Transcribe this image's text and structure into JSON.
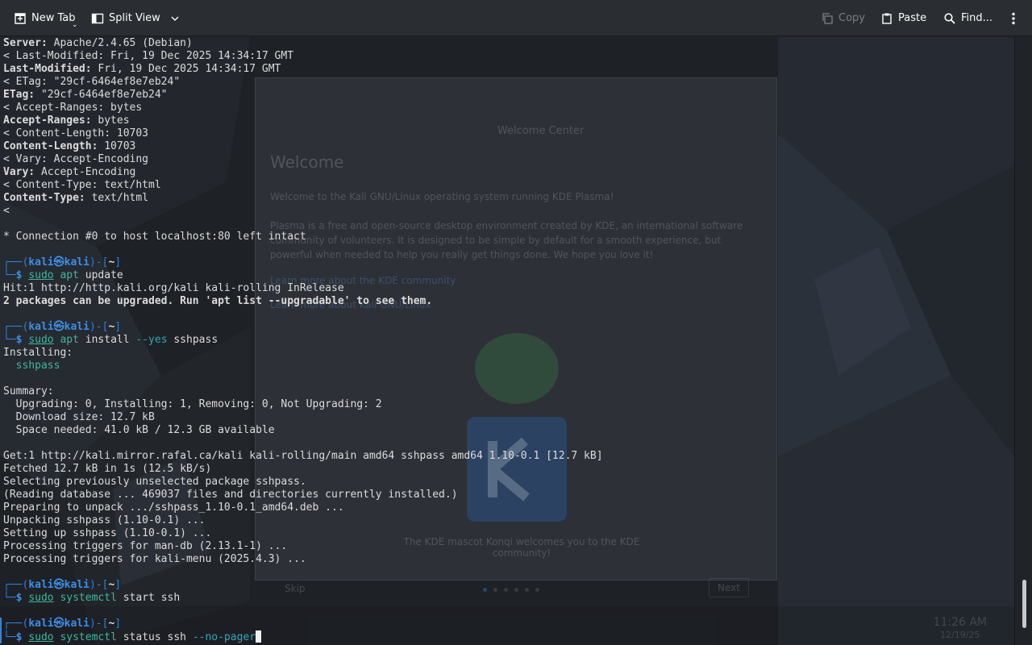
{
  "toolbar": {
    "new_tab": "New Tab",
    "split_view": "Split View",
    "copy": "Copy",
    "paste": "Paste",
    "find": "Find..."
  },
  "terminal": {
    "http_headers": [
      {
        "key": "Server:",
        "value": " Apache/2.4.65 (Debian)"
      },
      {
        "raw": "< Last-Modified: Fri, 19 Dec 2025 14:34:17 GMT"
      },
      {
        "key": "Last-Modified:",
        "value": " Fri, 19 Dec 2025 14:34:17 GMT"
      },
      {
        "raw": "< ETag: \"29cf-6464ef8e7eb24\""
      },
      {
        "key": "ETag:",
        "value": " \"29cf-6464ef8e7eb24\""
      },
      {
        "raw": "< Accept-Ranges: bytes"
      },
      {
        "key": "Accept-Ranges:",
        "value": " bytes"
      },
      {
        "raw": "< Content-Length: 10703"
      },
      {
        "key": "Content-Length:",
        "value": " 10703"
      },
      {
        "raw": "< Vary: Accept-Encoding"
      },
      {
        "key": "Vary:",
        "value": " Accept-Encoding"
      },
      {
        "raw": "< Content-Type: text/html"
      },
      {
        "key": "Content-Type:",
        "value": " text/html"
      },
      {
        "raw": "<"
      },
      {
        "raw": ""
      },
      {
        "raw": "* Connection #0 to host localhost:80 left intact"
      },
      {
        "raw": ""
      }
    ],
    "prompt": {
      "user": "kali",
      "host": "kali",
      "dir": "~",
      "symbol": "$"
    },
    "blocks": [
      {
        "command": [
          "sudo",
          " ",
          "apt",
          " update"
        ],
        "output": [
          {
            "text": "Hit:1 http://http.kali.org/kali kali-rolling InRelease"
          },
          {
            "text": "2 packages can be upgraded. Run 'apt list --upgradable' to see them.",
            "bold": true
          },
          {
            "text": ""
          }
        ]
      },
      {
        "command": [
          "sudo",
          " ",
          "apt",
          " install ",
          "--yes",
          " sshpass"
        ],
        "output": [
          {
            "text": "Installing:"
          },
          {
            "text": "  sshpass",
            "green": true
          },
          {
            "text": ""
          },
          {
            "text": "Summary:"
          },
          {
            "text": "  Upgrading: 0, Installing: 1, Removing: 0, Not Upgrading: 2"
          },
          {
            "text": "  Download size: 12.7 kB"
          },
          {
            "text": "  Space needed: 41.0 kB / 12.3 GB available"
          },
          {
            "text": ""
          },
          {
            "text": "Get:1 http://kali.mirror.rafal.ca/kali kali-rolling/main amd64 sshpass amd64 1.10-0.1 [12.7 kB]"
          },
          {
            "text": "Fetched 12.7 kB in 1s (12.5 kB/s)"
          },
          {
            "text": "Selecting previously unselected package sshpass."
          },
          {
            "text": "(Reading database ... 469037 files and directories currently installed.)"
          },
          {
            "text": "Preparing to unpack .../sshpass_1.10-0.1_amd64.deb ..."
          },
          {
            "text": "Unpacking sshpass (1.10-0.1) ..."
          },
          {
            "text": "Setting up sshpass (1.10-0.1) ..."
          },
          {
            "text": "Processing triggers for man-db (2.13.1-1) ..."
          },
          {
            "text": "Processing triggers for kali-menu (2025.4.3) ..."
          },
          {
            "text": ""
          }
        ]
      },
      {
        "command": [
          "sudo",
          " ",
          "systemctl",
          " start ssh"
        ],
        "output": [
          {
            "text": ""
          }
        ]
      },
      {
        "command": [
          "sudo",
          " ",
          "systemctl",
          " status ssh ",
          "--no-pager"
        ],
        "output": [],
        "cursor": true
      }
    ]
  },
  "background": {
    "welcome_title": "Welcome Center",
    "welcome_heading": "Welcome",
    "welcome_lines": [
      "Welcome to the Kali GNU/Linux operating system running KDE Plasma!",
      "Plasma is a free and open-source desktop environment created by KDE, an international software",
      "community of volunteers. It is designed to be simple by default for a smooth experience, but",
      "powerful when needed to help you really get things done. We hope you love it!"
    ],
    "welcome_links": [
      "Learn more about the KDE community",
      "Learn more about Kali GNU/Linux"
    ],
    "welcome_caption": "The KDE mascot Konqi welcomes you to the KDE community!",
    "skip": "Skip",
    "next": "Next",
    "clock_time": "11:26 AM",
    "clock_date": "12/19/25"
  },
  "colors": {
    "toolbar_bg": "#2a2e32",
    "prompt_blue": "#2f7fd6",
    "command_green": "#3fb59f",
    "text": "#dcdcdc"
  },
  "scrollbar": {
    "position": 0.97,
    "visible_fraction": 0.08
  }
}
